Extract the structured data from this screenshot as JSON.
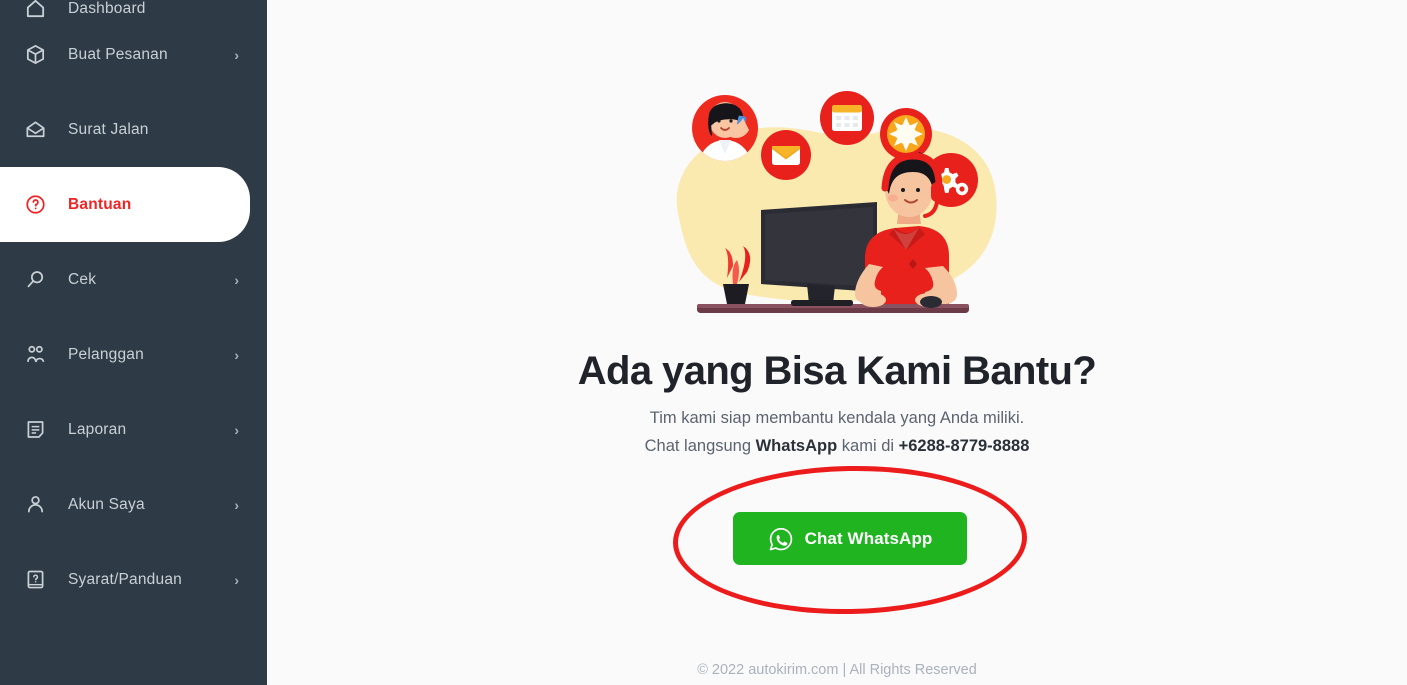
{
  "sidebar": {
    "background_color": "#2e3a45",
    "active_color": "#ef2424",
    "items": [
      {
        "label": "Dashboard",
        "icon": "home-icon",
        "has_chevron": false,
        "active": false,
        "chevron": "›"
      },
      {
        "label": "Buat Pesanan",
        "icon": "package-box-icon",
        "has_chevron": true,
        "active": false,
        "chevron": "›"
      },
      {
        "label": "Surat Jalan",
        "icon": "open-envelope-icon",
        "has_chevron": false,
        "active": false,
        "chevron": "›"
      },
      {
        "label": "Bantuan",
        "icon": "question-circle-icon",
        "has_chevron": false,
        "active": true,
        "chevron": "›"
      },
      {
        "label": "Cek",
        "icon": "magnifier-icon",
        "has_chevron": true,
        "active": false,
        "chevron": "›"
      },
      {
        "label": "Pelanggan",
        "icon": "users-icon",
        "has_chevron": true,
        "active": false,
        "chevron": "›"
      },
      {
        "label": "Laporan",
        "icon": "report-doc-icon",
        "has_chevron": true,
        "active": false,
        "chevron": "›"
      },
      {
        "label": "Akun Saya",
        "icon": "person-icon",
        "has_chevron": true,
        "active": false,
        "chevron": "›"
      },
      {
        "label": "Syarat/Panduan",
        "icon": "book-question-icon",
        "has_chevron": true,
        "active": false,
        "chevron": "›"
      }
    ]
  },
  "main": {
    "illustration": {
      "name": "customer-support-agent-illustration",
      "blob_color": "#fbeab0",
      "accent_color": "#e8291f",
      "badges": [
        "woman-on-phone-icon",
        "envelope-icon",
        "calendar-icon",
        "sun-burst-icon",
        "gear-icon"
      ]
    },
    "headline": "Ada yang Bisa Kami Bantu?",
    "sub_line_1": "Tim kami siap membantu kendala yang Anda miliki.",
    "sub_line_2_pre": "Chat langsung ",
    "sub_line_2_bold": "WhatsApp",
    "sub_line_2_mid": " kami di ",
    "phone": "+6288-8779-8888",
    "wa_button": {
      "label": "Chat WhatsApp",
      "color": "#21b421",
      "icon": "whatsapp-icon"
    },
    "annotation": {
      "name": "red-ellipse-highlight",
      "color": "#ed1c1c"
    },
    "footer": "© 2022 autokirim.com | All Rights Reserved"
  }
}
